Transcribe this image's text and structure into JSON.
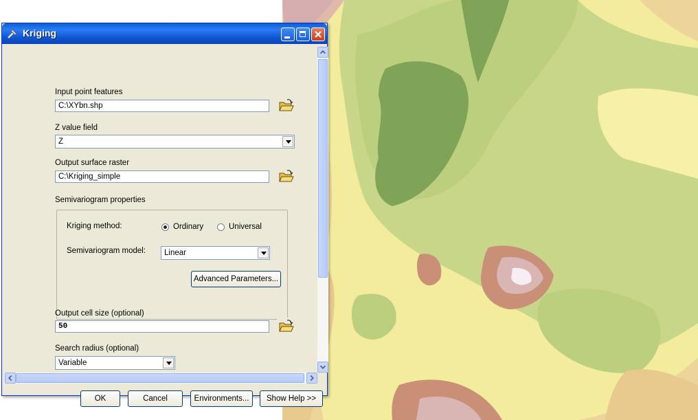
{
  "window": {
    "title": "Kriging"
  },
  "fields": {
    "input_point_features": {
      "label": "Input point features",
      "value": "C:\\XYbn.shp"
    },
    "z_value_field": {
      "label": "Z value field",
      "value": "Z"
    },
    "output_surface_raster": {
      "label": "Output surface raster",
      "value": "C:\\Kriging_simple"
    },
    "semivariogram_properties": {
      "label": "Semivariogram properties",
      "kriging_method_label": "Kriging method:",
      "option_ordinary": "Ordinary",
      "option_universal": "Universal",
      "selected_method": "Ordinary",
      "model_label": "Semivariogram model:",
      "model_value": "Linear",
      "advanced_button": "Advanced Parameters..."
    },
    "output_cell_size": {
      "label": "Output cell size (optional)",
      "value": "50"
    },
    "search_radius": {
      "label": "Search radius (optional)",
      "value": "Variable"
    }
  },
  "buttons": {
    "ok": "OK",
    "cancel": "Cancel",
    "environments": "Environments...",
    "show_help": "Show Help >>"
  },
  "colors": {
    "title_bar": "#0a5fd8",
    "dialog_bg": "#ece9d8",
    "map_dark_green": "#7a9f56",
    "map_light_green": "#bdcf7c",
    "map_yellow": "#f0e796",
    "map_brown": "#b57f67",
    "map_pink": "#d8b1b3"
  }
}
